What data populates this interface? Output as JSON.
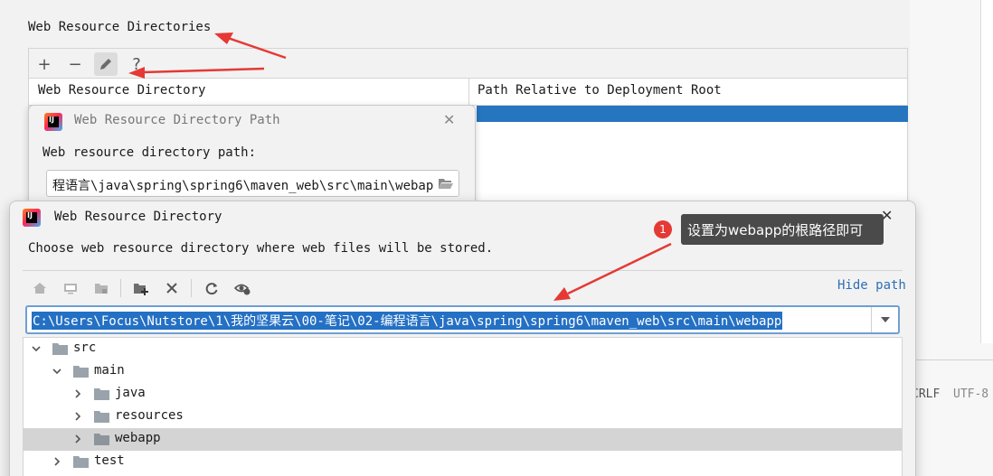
{
  "settings": {
    "section_title": "Web Resource Directories",
    "toolbar": {
      "add": "+",
      "remove": "−",
      "help": "?"
    },
    "columns": [
      "Web Resource Directory",
      "Path Relative to Deployment Root"
    ]
  },
  "status_bar": {
    "line_sep": "CRLF",
    "encoding": "UTF-8"
  },
  "path_dialog": {
    "title": "Web Resource Directory Path",
    "label": "Web resource directory path:",
    "value": "程语言\\java\\spring\\spring6\\maven_web\\src\\main\\webapp"
  },
  "chooser": {
    "title": "Web Resource Directory",
    "description": "Choose web resource directory where web files will be stored.",
    "hide_path": "Hide path",
    "path": "C:\\Users\\Focus\\Nutstore\\1\\我的坚果云\\00-笔记\\02-编程语言\\java\\spring\\spring6\\maven_web\\src\\main\\webapp",
    "tree": [
      {
        "label": "src",
        "expanded": true,
        "selected": false
      },
      {
        "label": "main",
        "expanded": true,
        "selected": false
      },
      {
        "label": "java",
        "expanded": false,
        "selected": false
      },
      {
        "label": "resources",
        "expanded": false,
        "selected": false
      },
      {
        "label": "webapp",
        "expanded": false,
        "selected": true
      },
      {
        "label": "test",
        "expanded": false,
        "selected": false
      }
    ]
  },
  "annotation": {
    "badge": "1",
    "text": "设置为webapp的根路径即可",
    "color": "#e53935"
  },
  "icons": [
    "home-icon",
    "desktop-icon",
    "project-icon",
    "new-folder-icon",
    "delete-icon",
    "refresh-icon",
    "show-hidden-icon",
    "folder-icon",
    "chevron-down-icon",
    "chevron-right-icon",
    "edit-icon",
    "close-icon"
  ]
}
